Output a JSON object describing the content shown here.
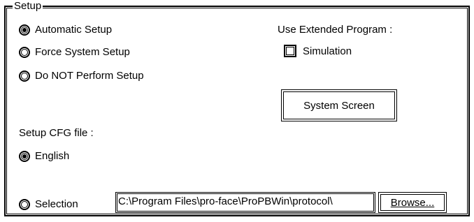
{
  "group": {
    "title": "Setup"
  },
  "setup_options": [
    {
      "label": "Automatic Setup",
      "checked": true
    },
    {
      "label": "Force System Setup",
      "checked": false
    },
    {
      "label": "Do NOT Perform Setup",
      "checked": false
    }
  ],
  "extended": {
    "label": "Use Extended Program :",
    "simulation_label": "Simulation",
    "simulation_checked": false
  },
  "system_screen_button": "System Screen",
  "cfg": {
    "label": "Setup CFG file :",
    "english_label": "English",
    "english_checked": true,
    "selection_label": "Selection",
    "selection_checked": false,
    "path_value": "C:\\Program Files\\pro-face\\ProPBWin\\protocol\\",
    "browse_label": "Browse..."
  }
}
